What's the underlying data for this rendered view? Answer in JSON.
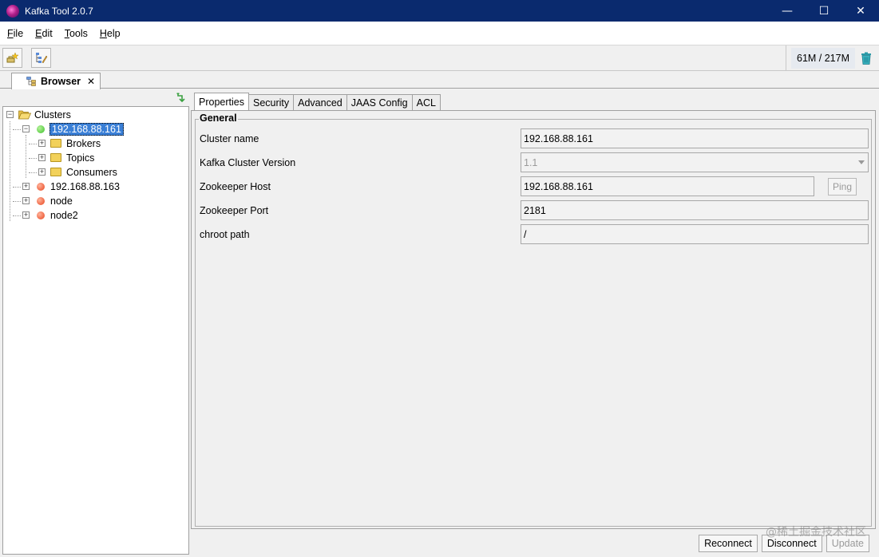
{
  "window": {
    "title": "Kafka Tool  2.0.7",
    "controls": {
      "minimize": "—",
      "maximize": "☐",
      "close": "✕"
    }
  },
  "menu": {
    "items": [
      {
        "key": "F",
        "rest": "ile"
      },
      {
        "key": "E",
        "rest": "dit"
      },
      {
        "key": "T",
        "rest": "ools"
      },
      {
        "key": "H",
        "rest": "elp"
      }
    ]
  },
  "toolbar": {
    "memory": "61M / 217M",
    "icons": [
      "add-cluster-icon",
      "edit-cluster-icon",
      "trash-icon"
    ]
  },
  "browser_tab": {
    "label": "Browser",
    "close": "✕"
  },
  "tree": {
    "root": "Clusters",
    "clusters": [
      {
        "name": "192.168.88.161",
        "status": "connected",
        "children": [
          "Brokers",
          "Topics",
          "Consumers"
        ]
      },
      {
        "name": "192.168.88.163",
        "status": "disconnected"
      },
      {
        "name": "node",
        "status": "disconnected"
      },
      {
        "name": "node2",
        "status": "disconnected"
      }
    ],
    "expand_plus": "+",
    "expand_minus": "−"
  },
  "tabs": [
    "Properties",
    "Security",
    "Advanced",
    "JAAS Config",
    "ACL"
  ],
  "active_tab": "Properties",
  "general": {
    "title": "General",
    "cluster_name_label": "Cluster name",
    "cluster_name": "192.168.88.161",
    "version_label": "Kafka Cluster Version",
    "version": "1.1",
    "zk_host_label": "Zookeeper Host",
    "zk_host": "192.168.88.161",
    "ping_label": "Ping",
    "zk_port_label": "Zookeeper Port",
    "zk_port": "2181",
    "chroot_label": "chroot path",
    "chroot": "/"
  },
  "buttons": {
    "reconnect": "Reconnect",
    "disconnect": "Disconnect",
    "update": "Update"
  },
  "watermark": "@稀土掘金技术社区",
  "colors": {
    "titlebar": "#0a2a6e",
    "selection": "#3a7fd6",
    "connected": "#3cbf2a",
    "disconnected": "#e8461f"
  }
}
